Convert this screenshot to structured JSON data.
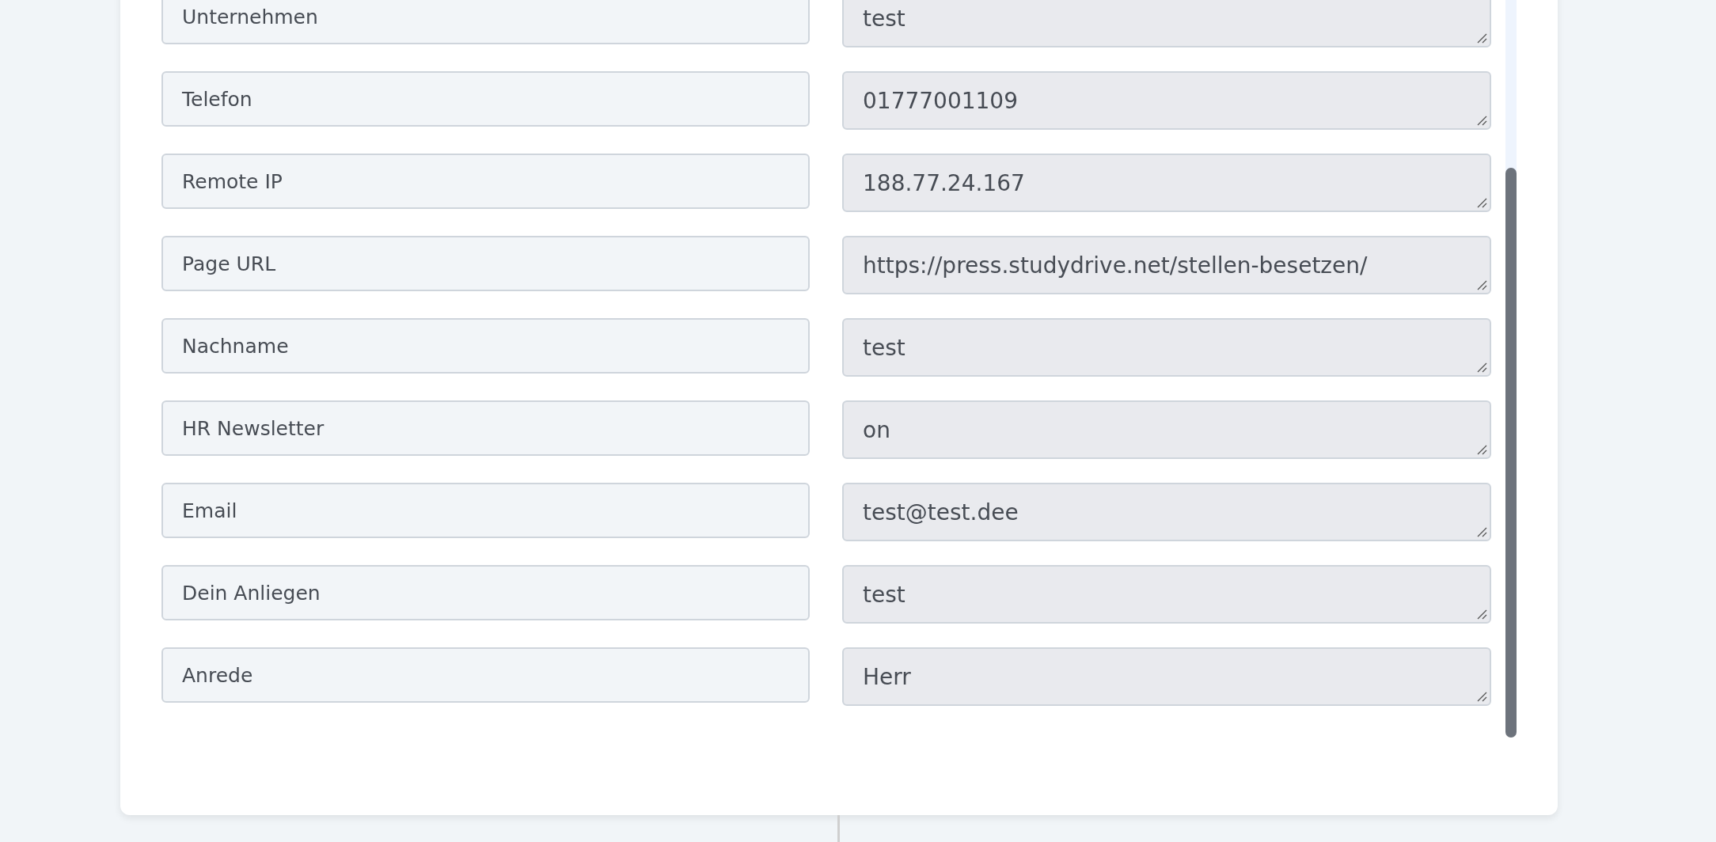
{
  "fields": [
    {
      "label": "Unternehmen",
      "value": "test"
    },
    {
      "label": "Telefon",
      "value": "01777001109"
    },
    {
      "label": "Remote IP",
      "value": "188.77.24.167"
    },
    {
      "label": "Page URL",
      "value": "https://press.studydrive.net/stellen-besetzen/"
    },
    {
      "label": "Nachname",
      "value": "test"
    },
    {
      "label": "HR Newsletter",
      "value": "on"
    },
    {
      "label": "Email",
      "value": "test@test.dee"
    },
    {
      "label": "Dein Anliegen",
      "value": "test"
    },
    {
      "label": "Anrede",
      "value": "Herr"
    }
  ]
}
